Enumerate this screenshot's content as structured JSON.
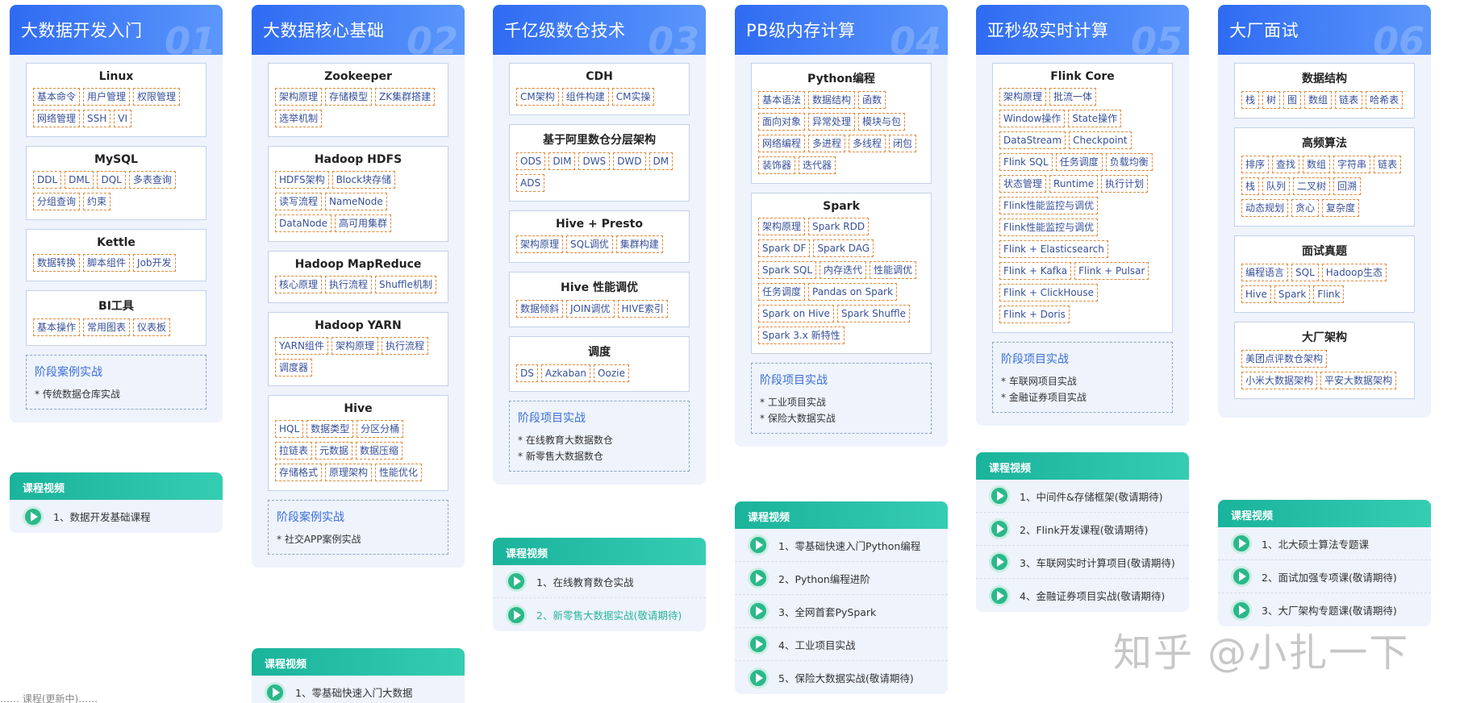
{
  "stages": [
    {
      "title": "大数据开发入门",
      "num": "01",
      "cards": [
        {
          "title": "Linux",
          "tags": [
            "基本命令",
            "用户管理",
            "权限管理",
            "网络管理",
            "SSH",
            "VI"
          ]
        },
        {
          "title": "MySQL",
          "tags": [
            "DDL",
            "DML",
            "DQL",
            "多表查询",
            "分组查询",
            "约束"
          ]
        },
        {
          "title": "Kettle",
          "tags": [
            "数据转换",
            "脚本组件",
            "Job开发"
          ]
        },
        {
          "title": "BI工具",
          "tags": [
            "基本操作",
            "常用图表",
            "仪表板"
          ]
        }
      ],
      "project": {
        "title": "阶段案例实战",
        "items": [
          "* 传统数据仓库实战"
        ]
      },
      "video": {
        "label": "课程视频",
        "items": [
          {
            "text": "1、数据开发基础课程",
            "dim": false
          }
        ]
      }
    },
    {
      "title": "大数据核心基础",
      "num": "02",
      "cards": [
        {
          "title": "Zookeeper",
          "tags": [
            "架构原理",
            "存储模型",
            "ZK集群搭建",
            "选举机制"
          ]
        },
        {
          "title": "Hadoop HDFS",
          "tags": [
            "HDFS架构",
            "Block块存储",
            "读写流程",
            "NameNode",
            "DataNode",
            "高可用集群"
          ]
        },
        {
          "title": "Hadoop MapReduce",
          "tags": [
            "核心原理",
            "执行流程",
            "Shuffle机制"
          ]
        },
        {
          "title": "Hadoop YARN",
          "tags": [
            "YARN组件",
            "架构原理",
            "执行流程",
            "调度器"
          ]
        },
        {
          "title": "Hive",
          "tags": [
            "HQL",
            "数据类型",
            "分区分桶",
            "拉链表",
            "元数据",
            "数据压缩",
            "存储格式",
            "原理架构",
            "性能优化"
          ]
        }
      ],
      "project": {
        "title": "阶段案例实战",
        "items": [
          "* 社交APP案例实战"
        ]
      },
      "video": {
        "label": "课程视频",
        "items": [
          {
            "text": "1、零基础快速入门大数据",
            "dim": false
          }
        ]
      }
    },
    {
      "title": "千亿级数仓技术",
      "num": "03",
      "cards": [
        {
          "title": "CDH",
          "tags": [
            "CM架构",
            "组件构建",
            "CM实操"
          ]
        },
        {
          "title": "基于阿里数仓分层架构",
          "tags": [
            "ODS",
            "DIM",
            "DWS",
            "DWD",
            "DM",
            "ADS"
          ]
        },
        {
          "title": "Hive + Presto",
          "tags": [
            "架构原理",
            "SQL调优",
            "集群构建"
          ]
        },
        {
          "title": "Hive 性能调优",
          "tags": [
            "数据倾斜",
            "JOIN调优",
            "HIVE索引"
          ]
        },
        {
          "title": "调度",
          "tags": [
            "DS",
            "Azkaban",
            "Oozie"
          ]
        }
      ],
      "project": {
        "title": "阶段项目实战",
        "items": [
          "* 在线教育大数据数仓",
          "* 新零售大数据数仓"
        ]
      },
      "video": {
        "label": "课程视频",
        "items": [
          {
            "text": "1、在线教育数仓实战",
            "dim": false
          },
          {
            "text": "2、新零售大数据实战(敬请期待)",
            "dim": true
          }
        ]
      }
    },
    {
      "title": "PB级内存计算",
      "num": "04",
      "cards": [
        {
          "title": "Python编程",
          "tags": [
            "基本语法",
            "数据结构",
            "函数",
            "面向对象",
            "异常处理",
            "模块与包",
            "网络编程",
            "多进程",
            "多线程",
            "闭包",
            "装饰器",
            "迭代器"
          ]
        },
        {
          "title": "Spark",
          "tags": [
            "架构原理",
            "Spark RDD",
            "Spark DF",
            "Spark DAG",
            "Spark SQL",
            "内存迭代",
            "性能调优",
            "任务调度",
            "Pandas on Spark",
            "Spark on Hive",
            "Spark Shuffle",
            "Spark 3.x 新特性"
          ]
        }
      ],
      "project": {
        "title": "阶段项目实战",
        "items": [
          "* 工业项目实战",
          "* 保险大数据实战"
        ]
      },
      "video": {
        "label": "课程视频",
        "items": [
          {
            "text": "1、零基础快速入门Python编程",
            "dim": false
          },
          {
            "text": "2、Python编程进阶",
            "dim": false
          },
          {
            "text": "3、全网首套PySpark",
            "dim": false
          },
          {
            "text": "4、工业项目实战",
            "dim": false
          },
          {
            "text": "5、保险大数据实战(敬请期待)",
            "dim": false
          }
        ]
      }
    },
    {
      "title": "亚秒级实时计算",
      "num": "05",
      "cards": [
        {
          "title": "Flink Core",
          "tags": [
            "架构原理",
            "批流一体",
            "Window操作",
            "State操作",
            "DataStream",
            "Checkpoint",
            "Flink SQL",
            "任务调度",
            "负载均衡",
            "状态管理",
            "Runtime",
            "执行计划",
            "Flink性能监控与调优",
            "Flink性能监控与调优",
            "Flink + Elasticsearch",
            "Flink + Kafka",
            "Flink + Pulsar",
            "Flink + ClickHouse",
            "Flink + Doris"
          ]
        }
      ],
      "project": {
        "title": "阶段项目实战",
        "items": [
          "* 车联网项目实战",
          "* 金融证券项目实战"
        ]
      },
      "video": {
        "label": "课程视频",
        "items": [
          {
            "text": "1、中间件&存储框架(敬请期待)",
            "dim": false
          },
          {
            "text": "2、Flink开发课程(敬请期待)",
            "dim": false
          },
          {
            "text": "3、车联网实时计算项目(敬请期待)",
            "dim": false
          },
          {
            "text": "4、金融证券项目实战(敬请期待)",
            "dim": false
          }
        ]
      }
    },
    {
      "title": "大厂面试",
      "num": "06",
      "cards": [
        {
          "title": "数据结构",
          "tags": [
            "栈",
            "树",
            "图",
            "数组",
            "链表",
            "哈希表"
          ]
        },
        {
          "title": "高频算法",
          "tags": [
            "排序",
            "查找",
            "数组",
            "字符串",
            "链表",
            "栈",
            "队列",
            "二叉树",
            "回溯",
            "动态规划",
            "贪心",
            "复杂度"
          ]
        },
        {
          "title": "面试真题",
          "tags": [
            "编程语言",
            "SQL",
            "Hadoop生态",
            "Hive",
            "Spark",
            "Flink"
          ]
        },
        {
          "title": "大厂架构",
          "tags": [
            "美团点评数仓架构",
            "小米大数据架构",
            "平安大数据架构"
          ]
        }
      ],
      "project": null,
      "video": {
        "label": "课程视频",
        "items": [
          {
            "text": "1、北大硕士算法专题课",
            "dim": false
          },
          {
            "text": "2、面试加强专项课(敬请期待)",
            "dim": false
          },
          {
            "text": "3、大厂架构专题课(敬请期待)",
            "dim": false
          }
        ]
      }
    }
  ],
  "watermark": "知乎 @小扎一下",
  "footer_cut": "…… 课程(更新中)……"
}
